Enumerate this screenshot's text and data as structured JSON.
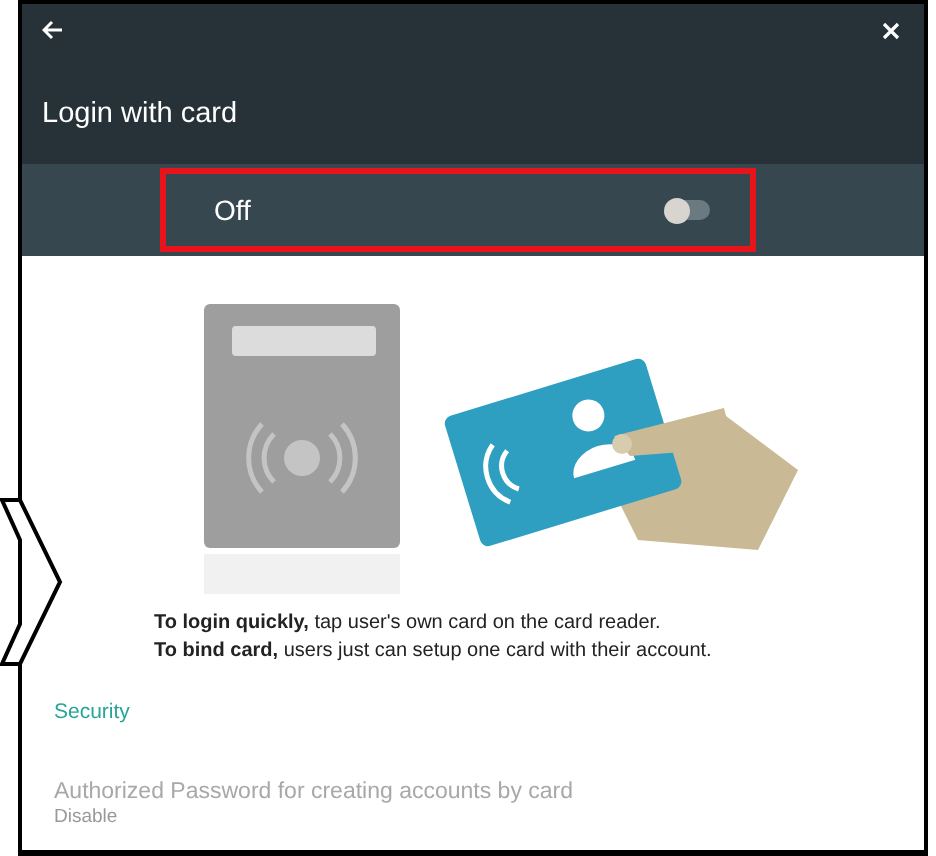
{
  "window": {
    "title": "Login with card"
  },
  "toggle": {
    "label": "Off",
    "on": false,
    "highlighted": true
  },
  "info": [
    "**To login quickly,** tap user's own card on the card reader.",
    "**To bind card,** users just can setup one card with their account."
  ],
  "sections": [
    {
      "title": "Security",
      "items": [
        {
          "title": "Authorized Password for creating accounts by card",
          "value": "Disable",
          "disabled": true
        }
      ]
    }
  ]
}
